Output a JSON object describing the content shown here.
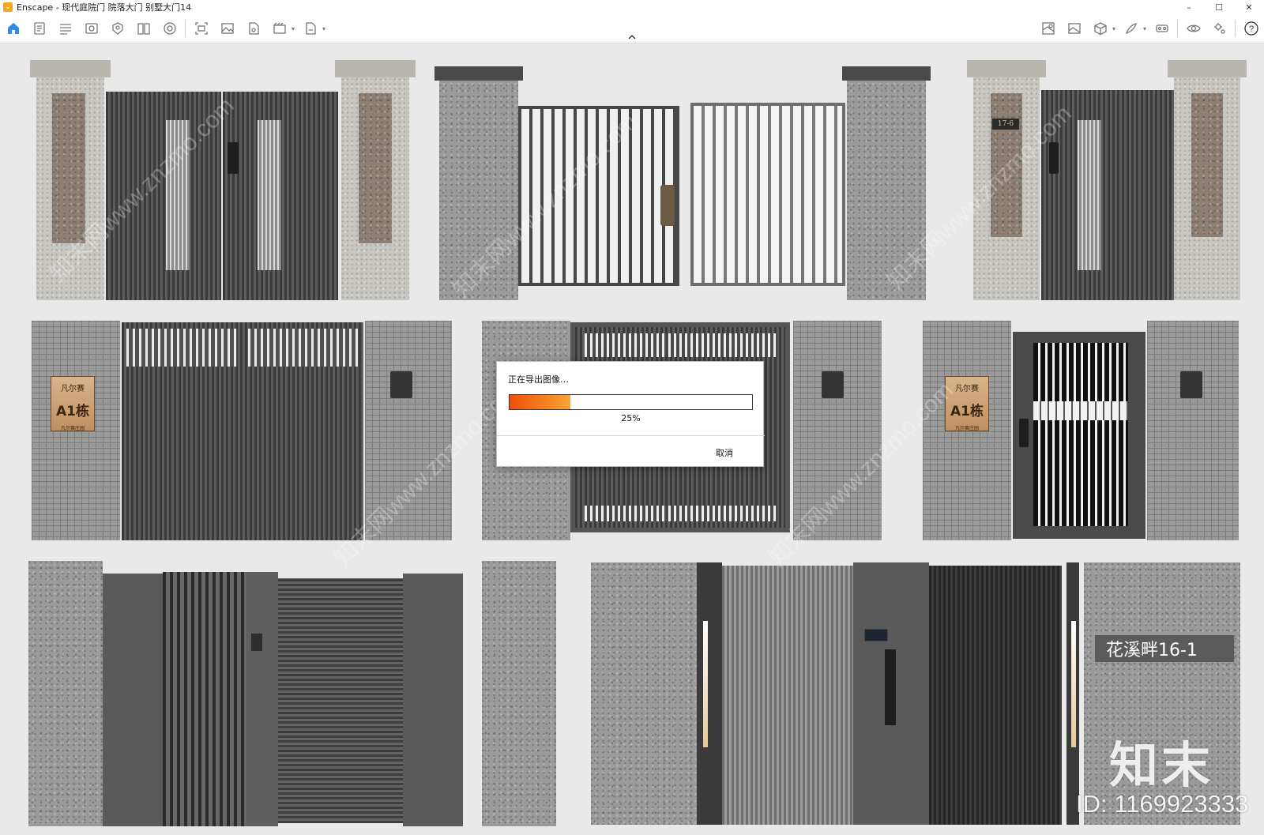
{
  "window": {
    "title": "Enscape - 现代庭院门 院落大门 别墅大门14",
    "controls": {
      "minimize": "–",
      "maximize": "☐",
      "close": "✕"
    }
  },
  "toolbar": {
    "left_icons": [
      "home-icon",
      "notes-icon",
      "sections-icon",
      "view-icon",
      "asset-library-icon",
      "atlas-icon",
      "materials-icon",
      "screenshot-icon",
      "image-icon",
      "batch-render-icon",
      "video-icon",
      "export-icon"
    ],
    "right_icons": [
      "map-icon",
      "gallery-icon",
      "cube-icon",
      "paint-icon",
      "vr-headset-icon",
      "visibility-icon",
      "settings-icon",
      "help-icon"
    ],
    "help_label": "?"
  },
  "dialog": {
    "title": "正在导出图像…",
    "progress": 0.25,
    "progress_text": "25%",
    "cancel_label": "取消"
  },
  "scene": {
    "house_plate_brand": "凡尔赛",
    "house_plate_number": "A1栋",
    "house_plate_footer": "凡尔赛庄园",
    "address_sign": "花溪畔16-1",
    "pillar_tag": "17-6"
  },
  "watermark": {
    "brand": "知末",
    "id_text": "ID: 1169923333",
    "diagonal": "知末网www.znzmo.com"
  },
  "colors": {
    "accent_orange": "#f6821e",
    "home_icon_blue": "#2f8de4"
  }
}
